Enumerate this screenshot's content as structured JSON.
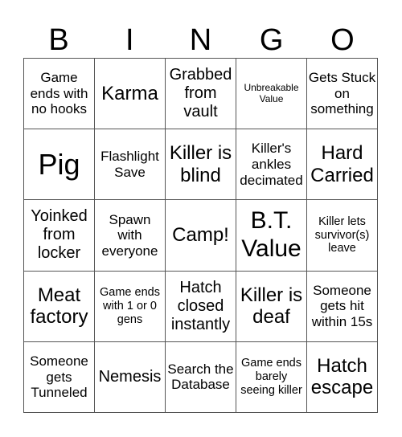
{
  "header": {
    "letters": [
      "B",
      "I",
      "N",
      "G",
      "O"
    ]
  },
  "grid": {
    "cells": [
      "Game ends with no hooks",
      "Karma",
      "Grabbed from vault",
      "Unbreakable Value",
      "Gets Stuck on something",
      "Pig",
      "Flashlight Save",
      "Killer is blind",
      "Killer's ankles decimated",
      "Hard Carried",
      "Yoinked from locker",
      "Spawn with everyone",
      "Camp!",
      "B.T. Value",
      "Killer lets survivor(s) leave",
      "Meat factory",
      "Game ends with 1 or 0 gens",
      "Hatch closed instantly",
      "Killer is deaf",
      "Someone gets hit within 15s",
      "Someone gets Tunneled",
      "Nemesis",
      "Search the Database",
      "Game ends barely seeing killer",
      "Hatch escape"
    ]
  }
}
